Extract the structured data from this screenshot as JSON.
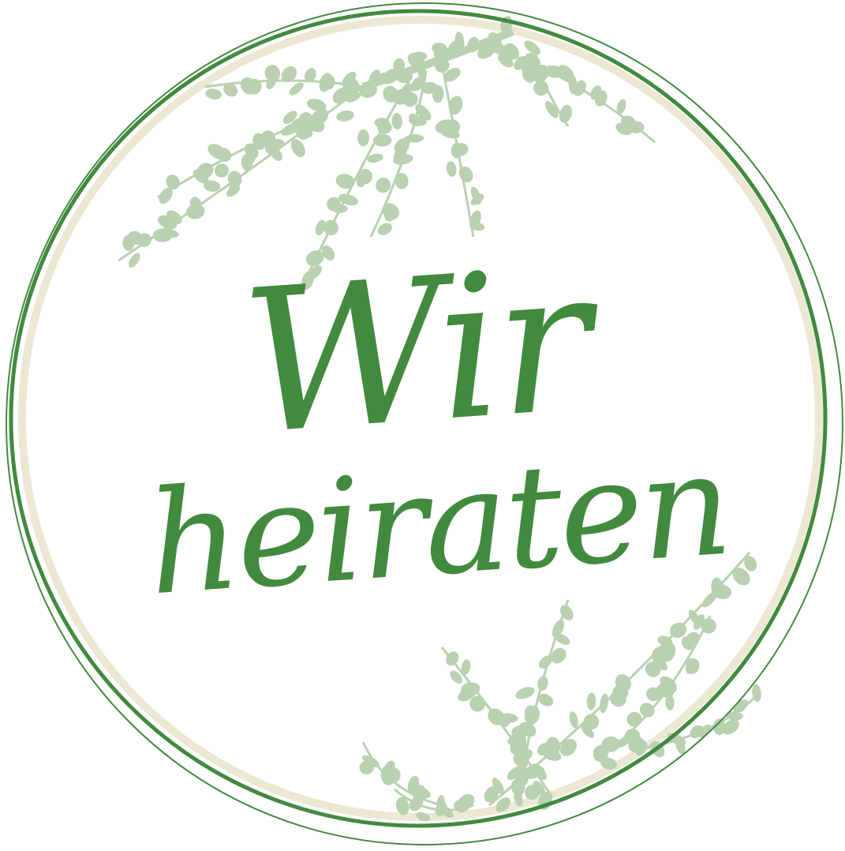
{
  "badge": {
    "title_line1": "Wir",
    "title_line2": "heiraten"
  },
  "colors": {
    "ring": "#428a3e",
    "ring_shadow": "#ece8d4",
    "text": "#428a3e",
    "leaves": "#b9d1b1"
  }
}
